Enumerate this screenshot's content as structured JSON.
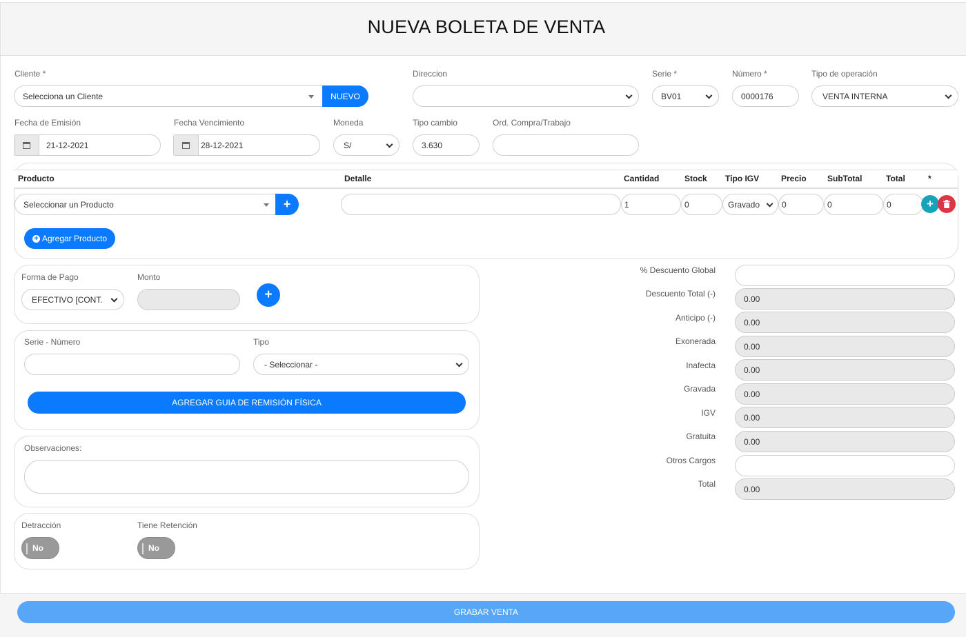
{
  "page": {
    "title": "NUEVA BOLETA DE VENTA"
  },
  "cliente": {
    "label": "Cliente *",
    "value": "Selecciona un Cliente",
    "nuevo_label": "NUEVO"
  },
  "direccion": {
    "label": "Direccion",
    "value": ""
  },
  "serie": {
    "label": "Serie *",
    "value": "BV01"
  },
  "numero": {
    "label": "Número *",
    "value": "0000176"
  },
  "tipo_operacion": {
    "label": "Tipo de operación",
    "value": "VENTA INTERNA"
  },
  "fecha_emision": {
    "label": "Fecha de Emisión",
    "value": "21-12-2021"
  },
  "fecha_vencimiento": {
    "label": "Fecha Vencimiento",
    "value": "28-12-2021"
  },
  "moneda": {
    "label": "Moneda",
    "value": "S/"
  },
  "tipo_cambio": {
    "label": "Tipo cambio",
    "value": "3.630"
  },
  "ord_compra": {
    "label": "Ord. Compra/Trabajo",
    "value": ""
  },
  "products": {
    "headers": {
      "producto": "Producto",
      "detalle": "Detalle",
      "cantidad": "Cantidad",
      "stock": "Stock",
      "tipo_igv": "Tipo IGV",
      "precio": "Precio",
      "subtotal": "SubTotal",
      "total": "Total",
      "star": "*"
    },
    "row": {
      "producto": "Seleccionar un Producto",
      "detalle": "",
      "cantidad": "1",
      "stock": "0",
      "tipo_igv": "Gravado -",
      "precio": "0",
      "subtotal": "0",
      "total": "0"
    },
    "add_label": "Agregar Producto"
  },
  "pago": {
    "forma_label": "Forma de Pago",
    "forma_value": "EFECTIVO [CONT.",
    "monto_label": "Monto",
    "monto_value": ""
  },
  "guia": {
    "serie_label": "Serie - Número",
    "serie_value": "",
    "tipo_label": "Tipo",
    "tipo_value": "- Seleccionar -",
    "button_label": "AGREGAR GUIA DE REMISIÓN FÍSICA"
  },
  "observaciones": {
    "label": "Observaciones:",
    "value": ""
  },
  "detraccion": {
    "label": "Detracción",
    "value": "No"
  },
  "retencion": {
    "label": "Tiene Retención",
    "value": "No"
  },
  "summary": {
    "descuento_global": {
      "label": "% Descuento Global",
      "value": ""
    },
    "descuento_total": {
      "label": "Descuento Total (-)",
      "value": "0.00"
    },
    "anticipo": {
      "label": "Anticipo (-)",
      "value": "0.00"
    },
    "exonerada": {
      "label": "Exonerada",
      "value": "0.00"
    },
    "inafecta": {
      "label": "Inafecta",
      "value": "0.00"
    },
    "gravada": {
      "label": "Gravada",
      "value": "0.00"
    },
    "igv": {
      "label": "IGV",
      "value": "0.00"
    },
    "gratuita": {
      "label": "Gratuita",
      "value": "0.00"
    },
    "otros_cargos": {
      "label": "Otros Cargos",
      "value": ""
    },
    "total": {
      "label": "Total",
      "value": "0.00"
    }
  },
  "footer": {
    "grabar_label": "GRABAR VENTA"
  },
  "colors": {
    "accent": "#0a7bff",
    "save": "#58a6f7",
    "add_row": "#17a2b8",
    "delete": "#dc3545"
  },
  "icons": {
    "plus": "plus-icon",
    "trash": "trash-icon",
    "calendar": "calendar-icon",
    "chevron": "chevron-down-icon"
  }
}
